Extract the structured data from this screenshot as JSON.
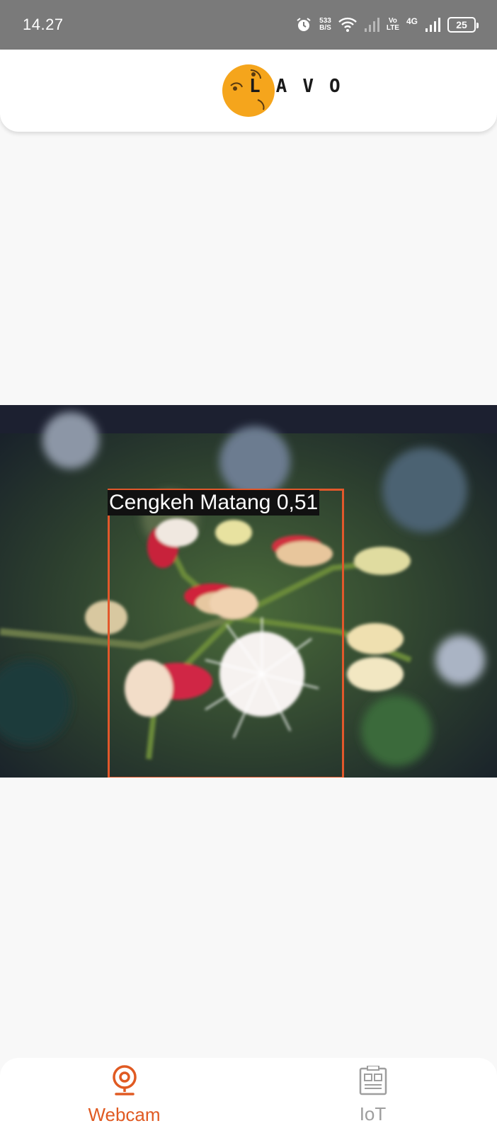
{
  "status_bar": {
    "time": "14.27",
    "net_speed_value": "533",
    "net_speed_unit": "B/S",
    "volte_top": "Vo",
    "volte_bottom": "LTE",
    "network_type": "4G",
    "battery_level": "25",
    "icons": [
      "alarm-icon",
      "wifi-icon",
      "signal-icon-sim1",
      "volte-icon",
      "signal-icon-sim2",
      "battery-icon"
    ]
  },
  "header": {
    "logo_letters": [
      "L",
      "A",
      "V",
      "O"
    ],
    "logo_color": "#f5a51c"
  },
  "camera": {
    "detection": {
      "label": "Cengkeh Matang 0,51",
      "box_color": "#e2582b"
    }
  },
  "bottom_nav": {
    "accent_color": "#e05a22",
    "items": [
      {
        "label": "Webcam",
        "icon": "webcam-icon",
        "active": true
      },
      {
        "label": "IoT",
        "icon": "iot-device-icon",
        "active": false
      }
    ]
  }
}
